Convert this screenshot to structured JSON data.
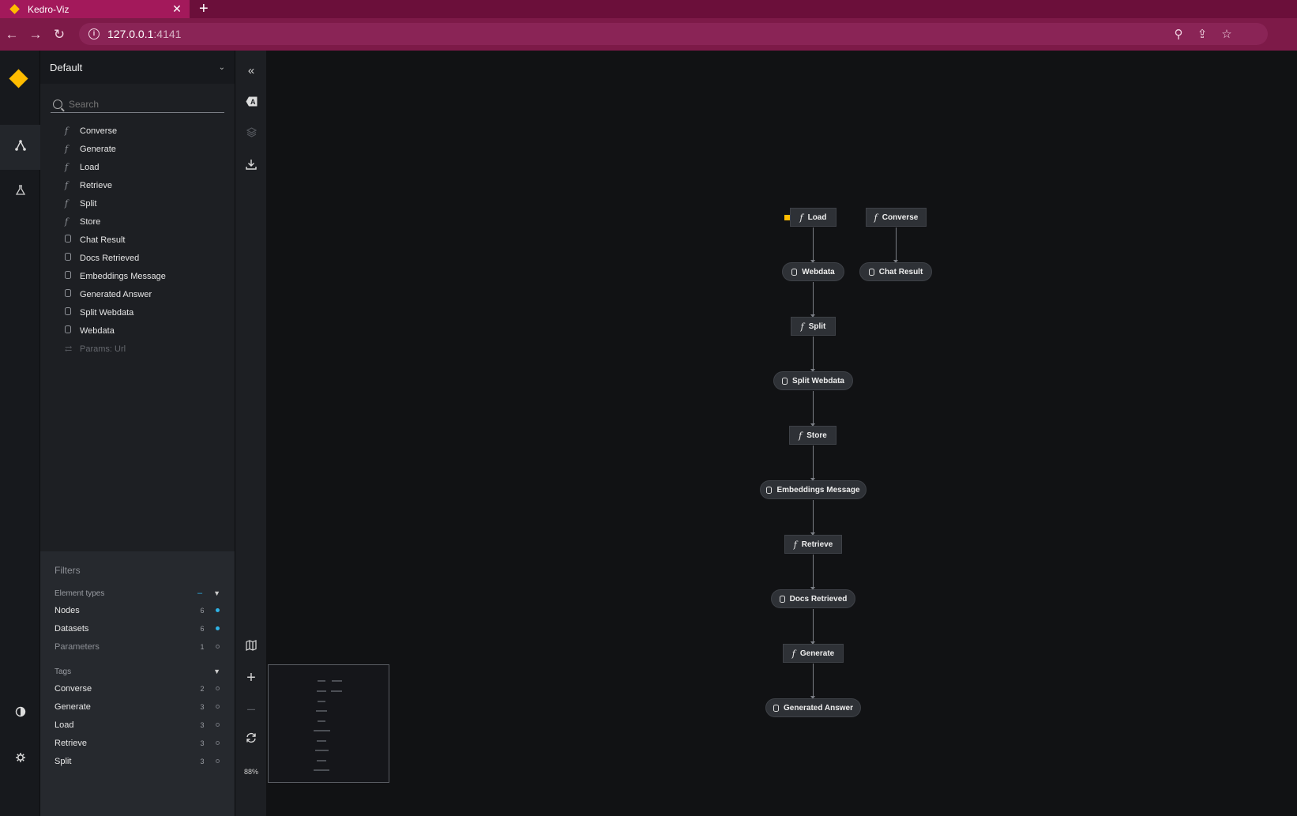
{
  "browser": {
    "tab_title": "Kedro-Viz",
    "tab_close": "✕",
    "new_tab": "+",
    "url_host": "127.0.0.1",
    "url_port": ":4141",
    "back_icon": "←",
    "forward_icon": "→",
    "reload_icon": "↻",
    "zoom_icon": "⚲",
    "share_icon": "⇪",
    "star_icon": "☆"
  },
  "sidebar": {
    "pipeline": "Default",
    "search_placeholder": "Search",
    "items": [
      {
        "label": "Converse",
        "kind": "task"
      },
      {
        "label": "Generate",
        "kind": "task"
      },
      {
        "label": "Load",
        "kind": "task"
      },
      {
        "label": "Retrieve",
        "kind": "task"
      },
      {
        "label": "Split",
        "kind": "task"
      },
      {
        "label": "Store",
        "kind": "task"
      },
      {
        "label": "Chat Result",
        "kind": "data"
      },
      {
        "label": "Docs Retrieved",
        "kind": "data"
      },
      {
        "label": "Embeddings Message",
        "kind": "data"
      },
      {
        "label": "Generated Answer",
        "kind": "data"
      },
      {
        "label": "Split Webdata",
        "kind": "data"
      },
      {
        "label": "Webdata",
        "kind": "data"
      },
      {
        "label": "Params: Url",
        "kind": "param"
      }
    ]
  },
  "filters": {
    "title": "Filters",
    "element_types_label": "Element types",
    "element_types": [
      {
        "label": "Nodes",
        "count": "6",
        "on": true
      },
      {
        "label": "Datasets",
        "count": "6",
        "on": true
      },
      {
        "label": "Parameters",
        "count": "1",
        "on": false
      }
    ],
    "tags_label": "Tags",
    "tags": [
      {
        "label": "Converse",
        "count": "2"
      },
      {
        "label": "Generate",
        "count": "3"
      },
      {
        "label": "Load",
        "count": "3"
      },
      {
        "label": "Retrieve",
        "count": "3"
      },
      {
        "label": "Split",
        "count": "3"
      }
    ]
  },
  "toolbar": {
    "zoom": "88%"
  },
  "graph": {
    "nodes": {
      "load": "Load",
      "converse": "Converse",
      "webdata": "Webdata",
      "chat_result": "Chat Result",
      "split": "Split",
      "split_webdata": "Split Webdata",
      "store": "Store",
      "embeddings_message": "Embeddings Message",
      "retrieve": "Retrieve",
      "docs_retrieved": "Docs Retrieved",
      "generate": "Generate",
      "generated_answer": "Generated Answer"
    }
  },
  "colors": {
    "accent": "#ffbc00",
    "tab_bar": "#6b0f3a",
    "filter_on": "#2fb3e6"
  }
}
